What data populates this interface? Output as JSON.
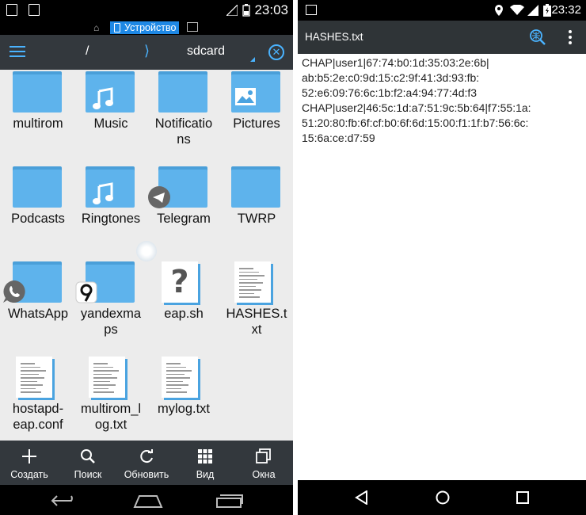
{
  "left": {
    "status_bar": {
      "time": "23:03"
    },
    "location_bar": {
      "device_label": "Устройство"
    },
    "path_bar": {
      "root": "/",
      "current": "sdcard",
      "chevron": "⟩"
    },
    "grid_items": [
      {
        "label": "multirom",
        "type": "folder",
        "badge": ""
      },
      {
        "label": "Music",
        "type": "folder",
        "badge": "music-note-icon"
      },
      {
        "label": "Notificatio\nns",
        "type": "folder",
        "badge": ""
      },
      {
        "label": "Pictures",
        "type": "folder",
        "badge": "image-icon"
      },
      {
        "label": "Podcasts",
        "type": "folder",
        "badge": ""
      },
      {
        "label": "Ringtones",
        "type": "folder",
        "badge": "music-note-icon"
      },
      {
        "label": "Telegram",
        "type": "folder",
        "badge": "telegram-icon"
      },
      {
        "label": "TWRP",
        "type": "folder",
        "badge": ""
      },
      {
        "label": "WhatsApp",
        "type": "folder",
        "badge": "whatsapp-icon"
      },
      {
        "label": "yandexma\nps",
        "type": "folder",
        "badge": "yandex-maps-icon"
      },
      {
        "label": "eap.sh",
        "type": "file",
        "badge": "question-mark-icon"
      },
      {
        "label": "HASHES.t\nxt",
        "type": "file",
        "badge": "text-file-icon"
      },
      {
        "label": "hostapd-\neap.conf",
        "type": "file",
        "badge": "text-file-icon"
      },
      {
        "label": "multirom_l\nog.txt",
        "type": "file",
        "badge": "text-file-icon"
      },
      {
        "label": "mylog.txt",
        "type": "file",
        "badge": "text-file-icon"
      }
    ],
    "bottom_toolbar": [
      {
        "label": "Создать",
        "icon": "plus-icon"
      },
      {
        "label": "Поиск",
        "icon": "search-icon"
      },
      {
        "label": "Обновить",
        "icon": "refresh-icon"
      },
      {
        "label": "Вид",
        "icon": "grid-view-icon"
      },
      {
        "label": "Окна",
        "icon": "windows-icon"
      }
    ]
  },
  "right": {
    "status_bar": {
      "time": "23:32"
    },
    "toolbar": {
      "title": "HASHES.txt"
    },
    "content": "CHAP|user1|67:74:b0:1d:35:03:2e:6b|\nab:b5:2e:c0:9d:15:c2:9f:41:3d:93:fb:\n52:e6:09:76:6c:1b:f2:a4:94:77:4d:f3\nCHAP|user2|46:5c:1d:a7:51:9c:5b:64|f7:55:1a:\n51:20:80:fb:6f:cf:b0:6f:6d:15:00:f1:1f:b7:56:6c:\n15:6a:ce:d7:59"
  },
  "colors": {
    "accent": "#4ab3ff",
    "folder": "#5eb3ec",
    "toolbar": "#33383d",
    "device_chip": "#1e88e5"
  }
}
